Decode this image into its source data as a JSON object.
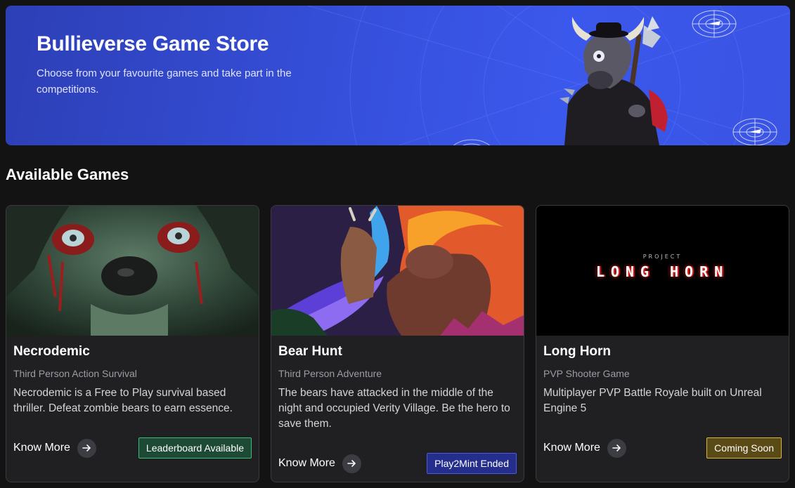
{
  "hero": {
    "title": "Bullieverse Game Store",
    "subtitle": "Choose from your favourite games and take part in the competitions."
  },
  "section": {
    "title": "Available Games"
  },
  "games": [
    {
      "title": "Necrodemic",
      "genre": "Third Person Action Survival",
      "description": "Necrodemic is a Free to Play survival based thriller. Defeat zombie bears to earn essence.",
      "cta": "Know More",
      "badge": "Leaderboard Available",
      "badge_color": "#3dbb7c"
    },
    {
      "title": "Bear Hunt",
      "genre": "Third Person Adventure",
      "description": "The bears have attacked in the middle of the night and occupied Verity Village. Be the hero to save them.",
      "cta": "Know More",
      "badge": "Play2Mint Ended",
      "badge_color": "#4b58e0"
    },
    {
      "title": "Long Horn",
      "genre": "PVP Shooter Game",
      "description": "Multiplayer PVP Battle Royale built on Unreal Engine 5",
      "cta": "Know More",
      "badge": "Coming Soon",
      "badge_color": "#d8b73a",
      "art_small": "PROJECT",
      "art_title": "LONG HORN"
    }
  ],
  "icons": {
    "arrow": "arrow-right-icon",
    "radar": "radar-icon"
  }
}
